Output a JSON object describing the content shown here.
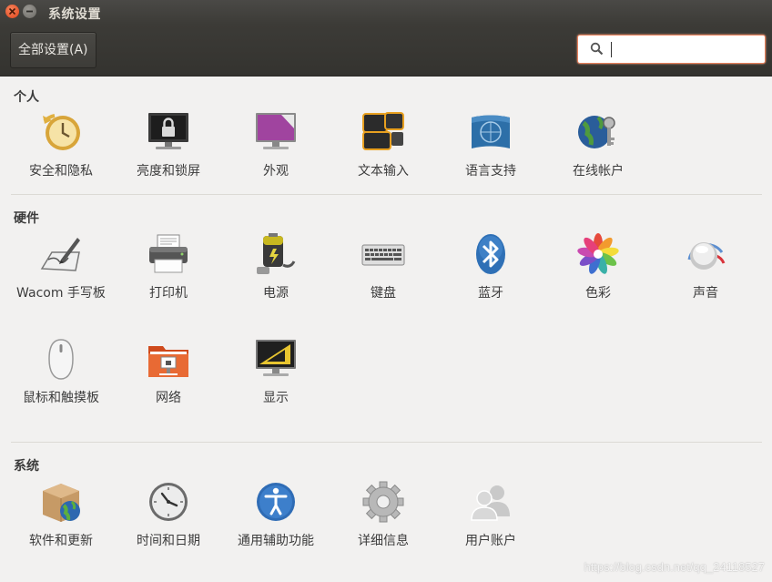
{
  "window": {
    "title": "系统设置",
    "close_icon": "close-icon",
    "minimize_icon": "minimize-icon"
  },
  "toolbar": {
    "all_settings_label": "全部设置(A)",
    "search_value": "",
    "search_placeholder": ""
  },
  "sections": {
    "personal": {
      "title": "个人",
      "items": [
        {
          "label": "安全和隐私",
          "icon": "security-privacy-icon"
        },
        {
          "label": "亮度和锁屏",
          "icon": "brightness-lock-icon"
        },
        {
          "label": "外观",
          "icon": "appearance-icon"
        },
        {
          "label": "文本输入",
          "icon": "text-entry-icon"
        },
        {
          "label": "语言支持",
          "icon": "language-support-icon"
        },
        {
          "label": "在线帐户",
          "icon": "online-accounts-icon"
        }
      ]
    },
    "hardware": {
      "title": "硬件",
      "items": [
        {
          "label": "Wacom 手写板",
          "icon": "wacom-tablet-icon"
        },
        {
          "label": "打印机",
          "icon": "printer-icon"
        },
        {
          "label": "电源",
          "icon": "power-icon"
        },
        {
          "label": "键盘",
          "icon": "keyboard-icon"
        },
        {
          "label": "蓝牙",
          "icon": "bluetooth-icon"
        },
        {
          "label": "色彩",
          "icon": "color-icon"
        },
        {
          "label": "声音",
          "icon": "sound-icon"
        },
        {
          "label": "鼠标和触摸板",
          "icon": "mouse-touchpad-icon"
        },
        {
          "label": "网络",
          "icon": "network-icon"
        },
        {
          "label": "显示",
          "icon": "display-icon"
        }
      ]
    },
    "system": {
      "title": "系统",
      "items": [
        {
          "label": "软件和更新",
          "icon": "software-updates-icon"
        },
        {
          "label": "时间和日期",
          "icon": "time-date-icon"
        },
        {
          "label": "通用辅助功能",
          "icon": "universal-access-icon"
        },
        {
          "label": "详细信息",
          "icon": "details-icon"
        },
        {
          "label": "用户账户",
          "icon": "user-accounts-icon"
        }
      ]
    }
  },
  "watermark": "https://blog.csdn.net/qq_24118527",
  "colors": {
    "titlebar": "#3c3b37",
    "accent": "#e9815c",
    "background": "#f2f1f0"
  }
}
